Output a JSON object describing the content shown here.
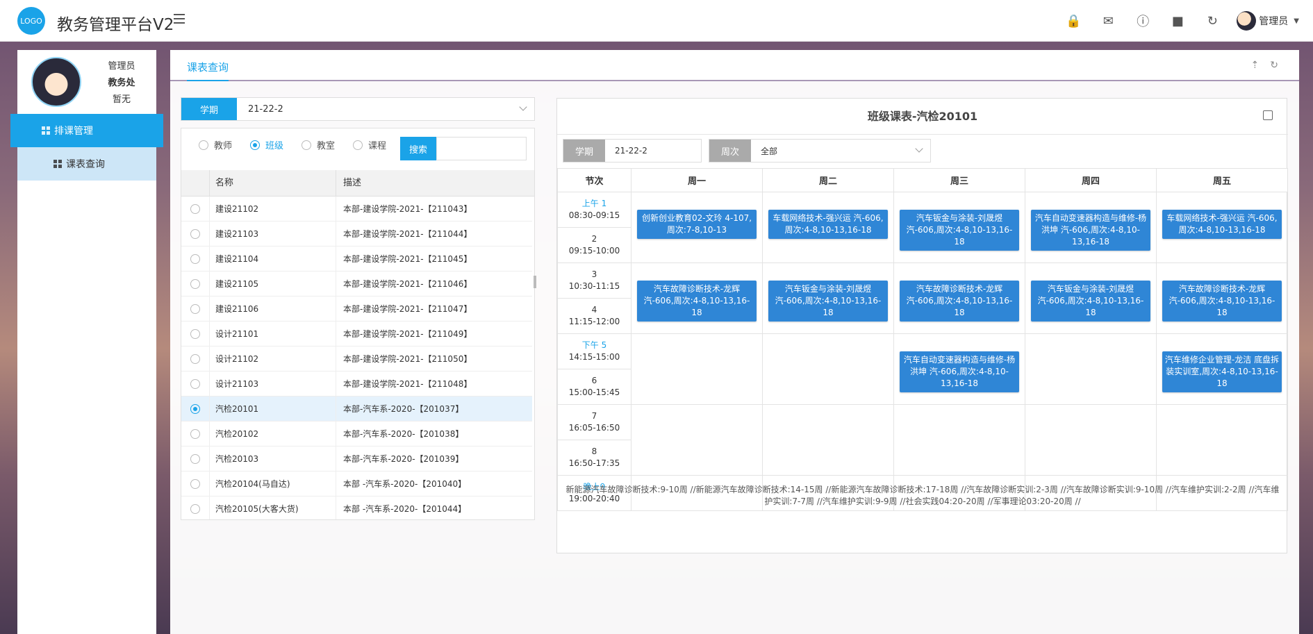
{
  "app": {
    "logo": "LOGO",
    "title": "教务管理平台V2",
    "user_name": "管理员"
  },
  "top_icons": [
    "lock-icon",
    "mail-icon",
    "help-icon",
    "theme-icon",
    "refresh-icon"
  ],
  "profile": {
    "role": "管理员",
    "dept": "教务处",
    "status": "暂无"
  },
  "nav": {
    "primary": "排课管理",
    "secondary": "课表查询"
  },
  "tab": {
    "label": "课表查询"
  },
  "left": {
    "term_label": "学期",
    "term_value": "21-22-2",
    "radios": [
      "教师",
      "班级",
      "教室",
      "课程"
    ],
    "radio_selected": 1,
    "search_label": "搜索",
    "columns": [
      "名称",
      "描述"
    ],
    "rows": [
      {
        "name": "建设21102",
        "desc": "本部-建设学院-2021-【211043】"
      },
      {
        "name": "建设21103",
        "desc": "本部-建设学院-2021-【211044】"
      },
      {
        "name": "建设21104",
        "desc": "本部-建设学院-2021-【211045】"
      },
      {
        "name": "建设21105",
        "desc": "本部-建设学院-2021-【211046】"
      },
      {
        "name": "建设21106",
        "desc": "本部-建设学院-2021-【211047】"
      },
      {
        "name": "设计21101",
        "desc": "本部-建设学院-2021-【211049】"
      },
      {
        "name": "设计21102",
        "desc": "本部-建设学院-2021-【211050】"
      },
      {
        "name": "设计21103",
        "desc": "本部-建设学院-2021-【211048】"
      },
      {
        "name": "汽检20101",
        "desc": "本部-汽车系-2020-【201037】",
        "selected": true
      },
      {
        "name": "汽检20102",
        "desc": "本部-汽车系-2020-【201038】"
      },
      {
        "name": "汽检20103",
        "desc": "本部-汽车系-2020-【201039】"
      },
      {
        "name": "汽检20104(马自达)",
        "desc": "本部 -汽车系-2020-【201040】"
      },
      {
        "name": "汽检20105(大客大货)",
        "desc": "本部 -汽车系-2020-【201044】"
      }
    ]
  },
  "schedule": {
    "title": "班级课表-汽检20101",
    "term_label": "学期",
    "term_value": "21-22-2",
    "week_label": "周次",
    "week_value": "全部",
    "headers": [
      "节次",
      "周一",
      "周二",
      "周三",
      "周四",
      "周五"
    ],
    "periods": [
      {
        "label": "上午 1",
        "prefix_word": "上午",
        "num": "1",
        "time": "08:30-09:15"
      },
      {
        "label": "2",
        "time": "09:15-10:00"
      },
      {
        "label": "3",
        "time": "10:30-11:15"
      },
      {
        "label": "4",
        "time": "11:15-12:00"
      },
      {
        "label": "下午 5",
        "prefix_word": "下午",
        "num": "5",
        "time": "14:15-15:00"
      },
      {
        "label": "6",
        "time": "15:00-15:45"
      },
      {
        "label": "7",
        "time": "16:05-16:50"
      },
      {
        "label": "8",
        "time": "16:50-17:35"
      },
      {
        "label": "晚上9",
        "prefix_word": "晚上",
        "num": "9",
        "time": "19:00-20:40"
      }
    ],
    "courses": {
      "p1": [
        "创新创业教育02-文玲 4-107,周次:7-8,10-13",
        "车载网络技术-强兴运 汽-606,周次:4-8,10-13,16-18",
        "汽车钣金与涂装-刘晟煜 汽-606,周次:4-8,10-13,16-18",
        "汽车自动变速器构造与维修-杨洪坤 汽-606,周次:4-8,10-13,16-18",
        "车载网络技术-强兴运 汽-606,周次:4-8,10-13,16-18"
      ],
      "p3": [
        "汽车故障诊断技术-龙辉 汽-606,周次:4-8,10-13,16-18",
        "汽车钣金与涂装-刘晟煜 汽-606,周次:4-8,10-13,16-18",
        "汽车故障诊断技术-龙辉 汽-606,周次:4-8,10-13,16-18",
        "汽车钣金与涂装-刘晟煜 汽-606,周次:4-8,10-13,16-18",
        "汽车故障诊断技术-龙辉 汽-606,周次:4-8,10-13,16-18"
      ],
      "p5": [
        "",
        "",
        "汽车自动变速器构造与维修-杨洪坤 汽-606,周次:4-8,10-13,16-18",
        "",
        "汽车维修企业管理-龙洁 底盘拆装实训室,周次:4-8,10-13,16-18"
      ]
    },
    "note": "新能源汽车故障诊断技术:9-10周 //新能源汽车故障诊断技术:14-15周 //新能源汽车故障诊断技术:17-18周 //汽车故障诊断实训:2-3周 //汽车故障诊断实训:9-10周 //汽车维护实训:2-2周 //汽车维护实训:7-7周 //汽车维护实训:9-9周 //社会实践04:20-20周 //军事理论03:20-20周 //"
  },
  "colors": {
    "accent": "#1aa3e8",
    "course_block": "#2f86d6"
  }
}
